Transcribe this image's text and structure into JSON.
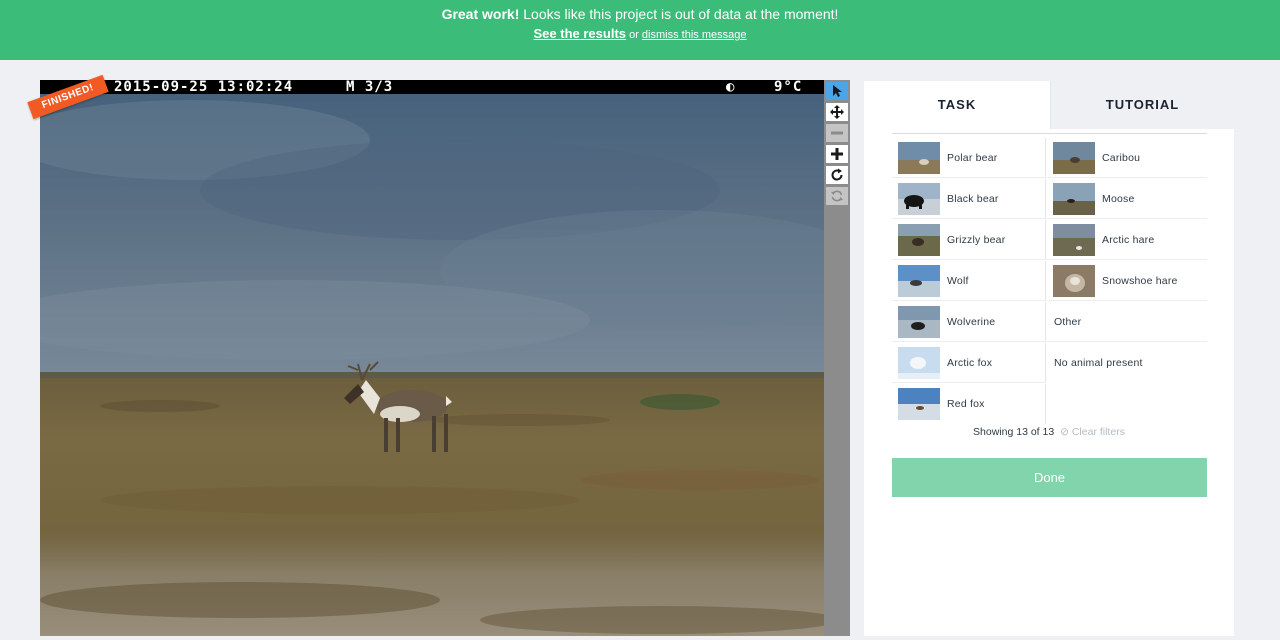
{
  "banner": {
    "strong": "Great work!",
    "message": " Looks like this project is out of data at the moment!",
    "results_link": "See the results",
    "or": " or ",
    "dismiss_link": "dismiss this message"
  },
  "camera": {
    "date_time": "2015-09-25 13:02:24",
    "mode": "M 3/3",
    "moon": "◐",
    "temperature": "9°C"
  },
  "badge": "FINISHED!",
  "toolbar": {
    "tools": [
      "pointer-icon",
      "move-icon",
      "zoom-out-icon",
      "zoom-in-icon",
      "rotate-icon",
      "reset-icon"
    ]
  },
  "tabs": {
    "task": "TASK",
    "tutorial": "TUTORIAL"
  },
  "choices": {
    "left": [
      {
        "label": "Polar bear",
        "thumb": "polar-bear-thumbnail"
      },
      {
        "label": "Black bear",
        "thumb": "black-bear-thumbnail"
      },
      {
        "label": "Grizzly bear",
        "thumb": "grizzly-bear-thumbnail"
      },
      {
        "label": "Wolf",
        "thumb": "wolf-thumbnail"
      },
      {
        "label": "Wolverine",
        "thumb": "wolverine-thumbnail"
      },
      {
        "label": "Arctic fox",
        "thumb": "arctic-fox-thumbnail"
      },
      {
        "label": "Red fox",
        "thumb": "red-fox-thumbnail"
      }
    ],
    "right": [
      {
        "label": "Caribou",
        "thumb": "caribou-thumbnail"
      },
      {
        "label": "Moose",
        "thumb": "moose-thumbnail"
      },
      {
        "label": "Arctic hare",
        "thumb": "arctic-hare-thumbnail"
      },
      {
        "label": "Snowshoe hare",
        "thumb": "snowshoe-hare-thumbnail"
      },
      {
        "label": "Other"
      },
      {
        "label": "No animal present"
      }
    ]
  },
  "filter": {
    "showing": "Showing 13 of 13",
    "clear": "Clear filters"
  },
  "done_label": "Done",
  "colors": {
    "banner": "#3bbd79",
    "done": "#81d4ac",
    "tool_active": "#4aa6e8",
    "badge": "#f25a24"
  }
}
